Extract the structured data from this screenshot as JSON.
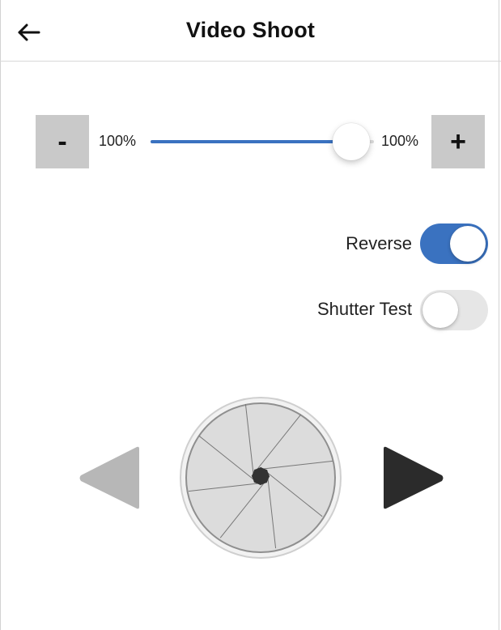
{
  "header": {
    "title": "Video Shoot",
    "back_icon": "arrow-left-icon"
  },
  "speed": {
    "minus_label": "-",
    "plus_label": "+",
    "left_value": "100%",
    "right_value": "100%",
    "slider_level": 0.9,
    "accent_color": "#3a72c0"
  },
  "toggles": {
    "reverse": {
      "label": "Reverse",
      "on": true
    },
    "shutter_test": {
      "label": "Shutter Test",
      "on": false
    }
  },
  "controls": {
    "prev_icon": "triangle-left-icon",
    "prev_color": "#b7b7b7",
    "next_icon": "triangle-right-icon",
    "next_color": "#2b2b2b",
    "shutter_icon": "camera-aperture-icon"
  }
}
